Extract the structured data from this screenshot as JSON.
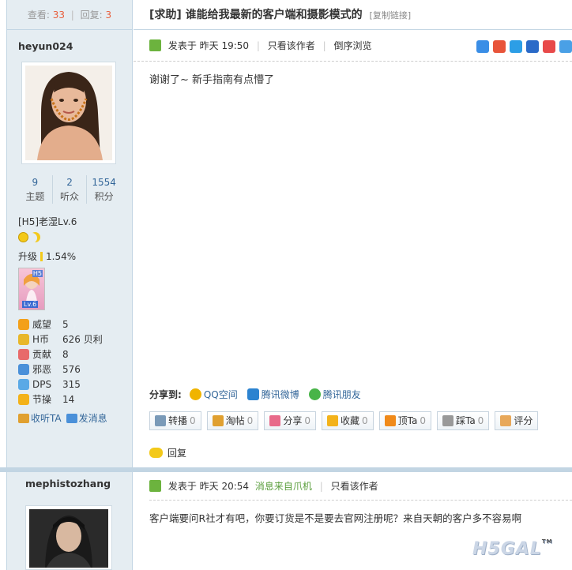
{
  "thread": {
    "views_label": "查看:",
    "views": "33",
    "replies_label": "回复:",
    "replies": "3",
    "title": "[求助] 谁能给我最新的客户端和摄影模式的",
    "copy_link": "[复制链接]"
  },
  "post1": {
    "author": "heyun024",
    "stats": [
      {
        "value": "9",
        "label": "主题"
      },
      {
        "value": "2",
        "label": "听众"
      },
      {
        "value": "1554",
        "label": "积分"
      }
    ],
    "rank": "[H5]老湿Lv.6",
    "upgrade_label": "升级",
    "upgrade_progress": "1.54%",
    "medal_tag": "H5",
    "medal_level": "Lv.6",
    "profile": [
      {
        "icon": "crown-icon",
        "label": "威望",
        "value": "5",
        "color": "#f3a01a"
      },
      {
        "icon": "coin-icon",
        "label": "H币",
        "value": "626 贝利",
        "color": "#e8b72a"
      },
      {
        "icon": "heart-icon",
        "label": "贡献",
        "value": "8",
        "color": "#e86a6a"
      },
      {
        "icon": "puzzle-icon",
        "label": "邪恶",
        "value": "576",
        "color": "#4a90d9"
      },
      {
        "icon": "star-icon",
        "label": "DPS",
        "value": "315",
        "color": "#5aa9e6"
      },
      {
        "icon": "bulb-icon",
        "label": "节操",
        "value": "14",
        "color": "#f3b21a"
      }
    ],
    "follow_label": "收听TA",
    "message_label": "发消息",
    "posted_prefix": "发表于",
    "posted_time": "昨天 19:50",
    "only_author": "只看该作者",
    "reverse": "倒序浏览",
    "content": "谢谢了~  新手指南有点懵了",
    "share_label": "分享到:",
    "share_targets": [
      "QQ空间",
      "腾讯微博",
      "腾讯朋友"
    ],
    "buttons": [
      {
        "label": "转播",
        "count": "0",
        "icon": "forward-icon",
        "color": "#7a9ab8"
      },
      {
        "label": "淘帖",
        "count": "0",
        "icon": "collect-icon",
        "color": "#e0a030"
      },
      {
        "label": "分享",
        "count": "0",
        "icon": "share-heart-icon",
        "color": "#e86a8a"
      },
      {
        "label": "收藏",
        "count": "0",
        "icon": "favorite-star-icon",
        "color": "#f3b21a"
      },
      {
        "label": "顶Ta",
        "count": "0",
        "icon": "up-arrow-icon",
        "color": "#f08a1a"
      },
      {
        "label": "踩Ta",
        "count": "0",
        "icon": "down-arrow-icon",
        "color": "#999999"
      },
      {
        "label": "评分",
        "count": "",
        "icon": "rate-thumb-icon",
        "color": "#e8a85a"
      }
    ],
    "reply_label": "回复"
  },
  "post2": {
    "author": "mephistozhang",
    "posted_prefix": "发表于",
    "posted_time": "昨天 20:54",
    "source": "消息来自爪机",
    "only_author": "只看该作者",
    "content": "客户端要问R社才有吧，你要订货是不是要去官网注册呢？来自天朝的客户多不容易啊"
  },
  "watermark": "H5GAL",
  "watermark_tm": "TM",
  "colors": {
    "accent": "#336699",
    "border": "#c2d5e3",
    "sidebar": "#e5edf2",
    "highlight": "#e85e3c"
  }
}
